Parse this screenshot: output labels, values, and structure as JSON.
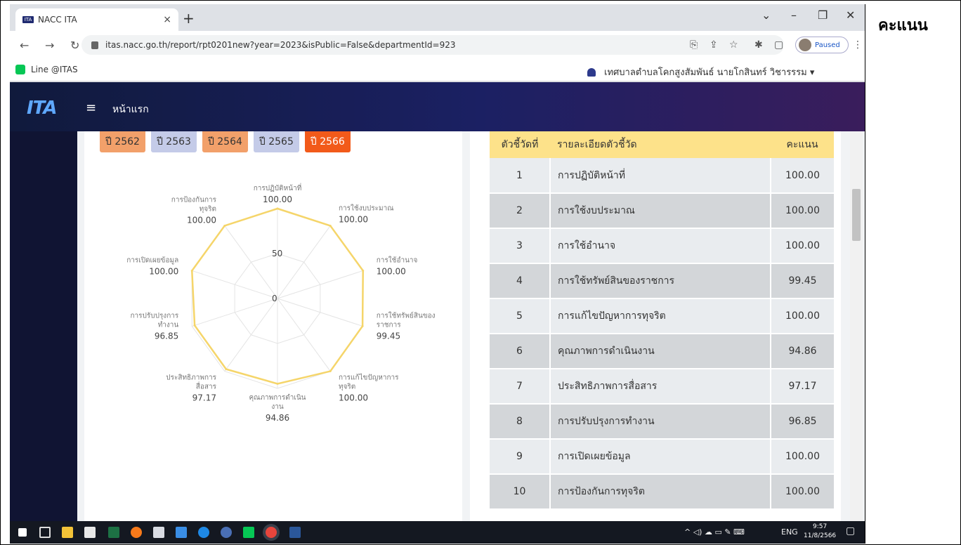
{
  "side_label": "คะแนน",
  "browser": {
    "tab_title": "NACC ITA",
    "tab_favicon": "ITA",
    "url": "itas.nacc.go.th/report/rpt0201new?year=2023&isPublic=False&departmentId=923",
    "profile_status": "Paused",
    "bookmark": "Line @ITAS",
    "user_org": "เทศบาลตำบลโคกสูงสัมพันธ์ นายโกสินทร์ วิชารรรม ▾"
  },
  "app": {
    "logo": "ITA",
    "home_link": "หน้าแรก"
  },
  "years": [
    {
      "label": "ปี 2562",
      "style": "orange"
    },
    {
      "label": "ปี 2563",
      "style": "blue"
    },
    {
      "label": "ปี 2564",
      "style": "orange"
    },
    {
      "label": "ปี 2565",
      "style": "blue"
    },
    {
      "label": "ปี 2566",
      "style": "active"
    }
  ],
  "chart_data": {
    "type": "radar",
    "scale_ticks": [
      "0",
      "50"
    ],
    "rmax": 100,
    "axes": [
      {
        "label": [
          "การปฏิบัติหน้าที่"
        ],
        "value_label": "100.00",
        "value": 100.0
      },
      {
        "label": [
          "การใช้งบประมาณ"
        ],
        "value_label": "100.00",
        "value": 100.0
      },
      {
        "label": [
          "การใช้อำนาจ"
        ],
        "value_label": "100.00",
        "value": 100.0
      },
      {
        "label": [
          "การใช้ทรัพย์สินของ",
          "ราชการ"
        ],
        "value_label": "99.45",
        "value": 99.45
      },
      {
        "label": [
          "การแก้ไขปัญหาการ",
          "ทุจริต"
        ],
        "value_label": "100.00",
        "value": 100.0
      },
      {
        "label": [
          "คุณภาพการดำเนิน",
          "งาน"
        ],
        "value_label": "94.86",
        "value": 94.86
      },
      {
        "label": [
          "ประสิทธิภาพการ",
          "สื่อสาร"
        ],
        "value_label": "97.17",
        "value": 97.17
      },
      {
        "label": [
          "การปรับปรุงการ",
          "ทำงาน"
        ],
        "value_label": "96.85",
        "value": 96.85
      },
      {
        "label": [
          "การเปิดเผยข้อมูล"
        ],
        "value_label": "100.00",
        "value": 100.0
      },
      {
        "label": [
          "การป้องกันการ",
          "ทุจริต"
        ],
        "value_label": "100.00",
        "value": 100.0
      }
    ],
    "line_color": "#f5d56a"
  },
  "table": {
    "headers": {
      "no": "ตัวชี้วัดที่",
      "desc": "รายละเอียดตัวชี้วัด",
      "score": "คะแนน"
    },
    "rows": [
      {
        "no": "1",
        "desc": "การปฏิบัติหน้าที่",
        "score": "100.00"
      },
      {
        "no": "2",
        "desc": "การใช้งบประมาณ",
        "score": "100.00"
      },
      {
        "no": "3",
        "desc": "การใช้อำนาจ",
        "score": "100.00"
      },
      {
        "no": "4",
        "desc": "การใช้ทรัพย์สินของราชการ",
        "score": "99.45"
      },
      {
        "no": "5",
        "desc": "การแก้ไขปัญหาการทุจริต",
        "score": "100.00"
      },
      {
        "no": "6",
        "desc": "คุณภาพการดำเนินงาน",
        "score": "94.86"
      },
      {
        "no": "7",
        "desc": "ประสิทธิภาพการสื่อสาร",
        "score": "97.17"
      },
      {
        "no": "8",
        "desc": "การปรับปรุงการทำงาน",
        "score": "96.85"
      },
      {
        "no": "9",
        "desc": "การเปิดเผยข้อมูล",
        "score": "100.00"
      },
      {
        "no": "10",
        "desc": "การป้องกันการทุจริต",
        "score": "100.00"
      }
    ]
  },
  "taskbar": {
    "language": "ENG",
    "time": "9:57",
    "date": "11/8/2566"
  }
}
